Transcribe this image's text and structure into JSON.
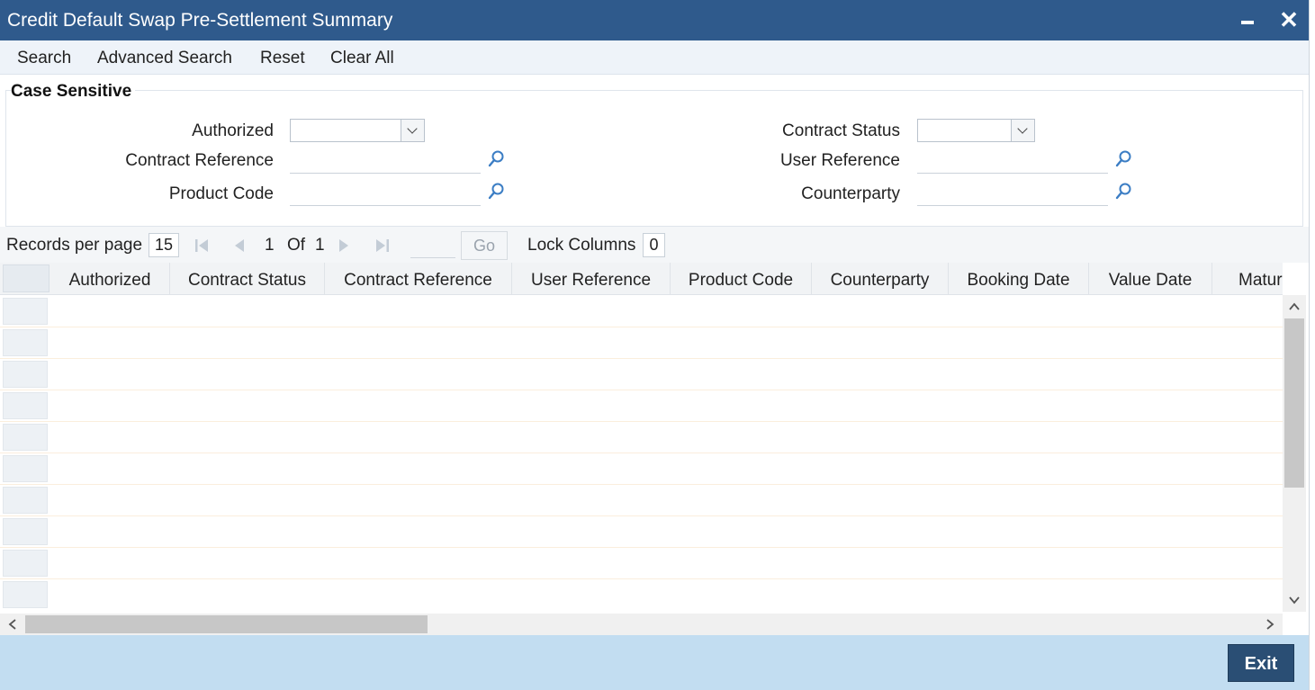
{
  "window": {
    "title": "Credit Default Swap Pre-Settlement Summary"
  },
  "toolbar": {
    "search": "Search",
    "advanced_search": "Advanced Search",
    "reset": "Reset",
    "clear_all": "Clear All"
  },
  "criteria": {
    "legend": "Case Sensitive",
    "authorized_label": "Authorized",
    "contract_status_label": "Contract Status",
    "contract_reference_label": "Contract Reference",
    "user_reference_label": "User Reference",
    "product_code_label": "Product Code",
    "counterparty_label": "Counterparty"
  },
  "pager": {
    "records_per_page_label": "Records per page",
    "records_per_page": "15",
    "current_page": "1",
    "of_label": "Of",
    "total_pages": "1",
    "go_label": "Go",
    "lock_columns_label": "Lock Columns",
    "lock_columns": "0"
  },
  "grid": {
    "columns": [
      "Authorized",
      "Contract Status",
      "Contract Reference",
      "User Reference",
      "Product Code",
      "Counterparty",
      "Booking Date",
      "Value Date",
      "Matur"
    ],
    "visible_rows": 10
  },
  "footer": {
    "exit": "Exit"
  },
  "colors": {
    "titlebar": "#2f5a8c",
    "footer": "#c2ddf1",
    "exit_button": "#2a4e74"
  }
}
